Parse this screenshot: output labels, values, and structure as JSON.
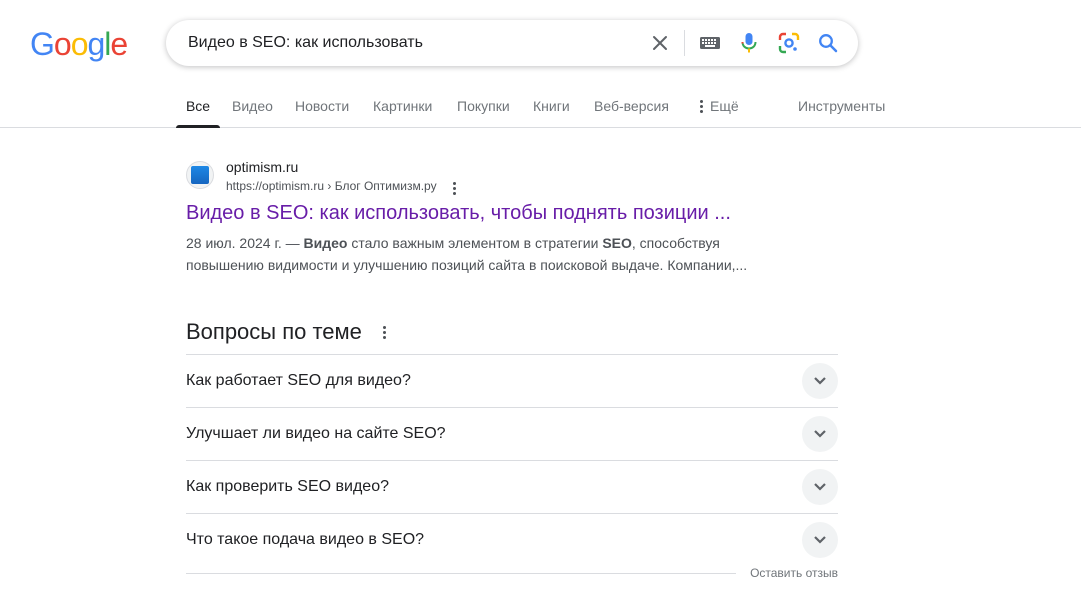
{
  "logo": {
    "letters": [
      "G",
      "o",
      "o",
      "g",
      "l",
      "e"
    ]
  },
  "search": {
    "query": "Видео в SEO: как использовать"
  },
  "tabs": [
    {
      "label": "Все",
      "active": true
    },
    {
      "label": "Видео"
    },
    {
      "label": "Новости"
    },
    {
      "label": "Картинки"
    },
    {
      "label": "Покупки"
    },
    {
      "label": "Книги"
    },
    {
      "label": "Веб-версия"
    },
    {
      "label": "Ещё"
    }
  ],
  "tools_label": "Инструменты",
  "result": {
    "site_name": "optimism.ru",
    "url": "https://optimism.ru",
    "breadcrumb": "› Блог Оптимизм.ру",
    "title": "Видео в SEO: как использовать, чтобы поднять позиции ...",
    "date": "28 июл. 2024 г. —",
    "snippet_b1": "Видео",
    "snippet_t1": " стало важным элементом в стратегии ",
    "snippet_b2": "SEO",
    "snippet_t2": ", способствуя повышению видимости и улучшению позиций сайта в поисковой выдаче. Компании,..."
  },
  "paa": {
    "heading": "Вопросы по теме",
    "questions": [
      "Как работает SEO для видео?",
      "Улучшает ли видео на сайте SEO?",
      "Как проверить SEO видео?",
      "Что такое подача видео в SEO?"
    ],
    "feedback": "Оставить отзыв"
  },
  "colors": {
    "visited_link": "#681da8",
    "google_blue": "#4285f4",
    "google_red": "#ea4335",
    "google_yellow": "#fbbc05",
    "google_green": "#34a853"
  },
  "icons": [
    "close-icon",
    "keyboard-icon",
    "microphone-icon",
    "lens-icon",
    "search-icon",
    "more-vert-icon",
    "chevron-down-icon"
  ]
}
